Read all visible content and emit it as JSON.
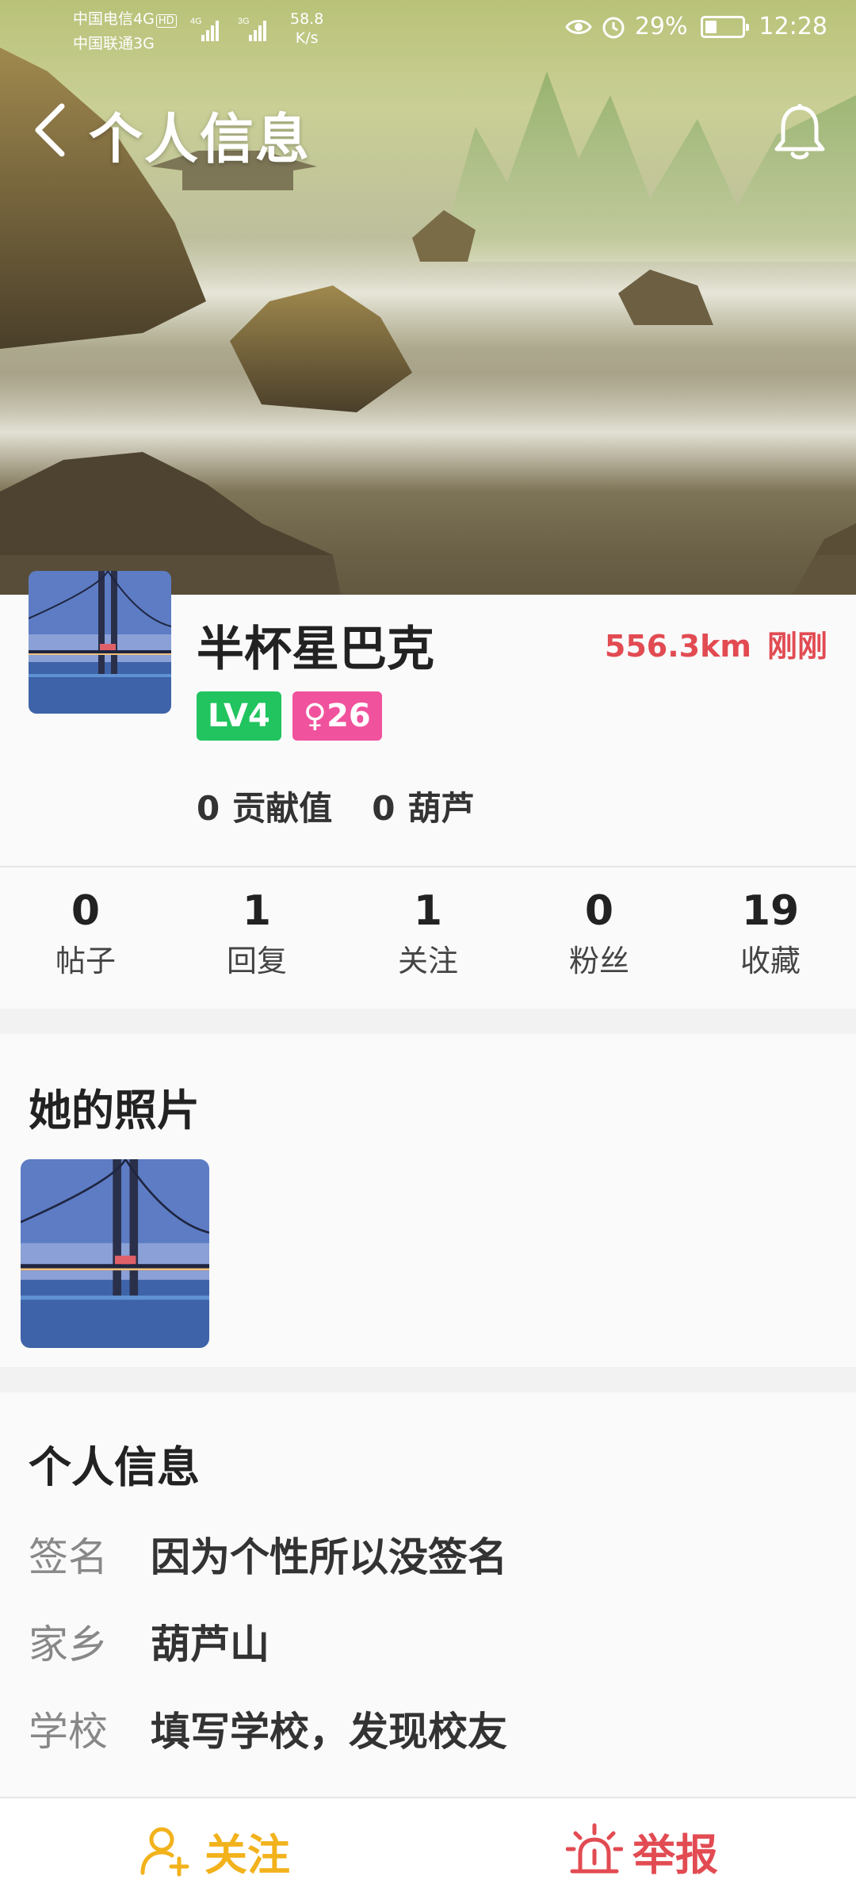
{
  "status_bar": {
    "carrier_1": "中国电信4G",
    "carrier_1_badge": "HD",
    "carrier_2": "中国联通3G",
    "net_1": "4G",
    "net_2": "3G",
    "speed_value": "58.8",
    "speed_unit": "K/s",
    "battery": "29%",
    "time": "12:28"
  },
  "header": {
    "title": "个人信息",
    "back_icon": "chevron-left-icon",
    "notify_icon": "bell-icon"
  },
  "profile": {
    "nickname": "半杯星巴克",
    "distance": "556.3km",
    "last_active": "刚刚",
    "level_badge": "LV4",
    "gender_age_badge": "♀26",
    "contribution_count": "0",
    "contribution_label": "贡献值",
    "gourd_count": "0",
    "gourd_label": "葫芦",
    "colors": {
      "level": "#21c45e",
      "gender": "#f0529d",
      "distance": "#e24b52"
    }
  },
  "counts": [
    {
      "value": "0",
      "label": "帖子"
    },
    {
      "value": "1",
      "label": "回复"
    },
    {
      "value": "1",
      "label": "关注"
    },
    {
      "value": "0",
      "label": "粉丝"
    },
    {
      "value": "19",
      "label": "收藏"
    }
  ],
  "photos": {
    "title": "她的照片"
  },
  "info": {
    "title": "个人信息",
    "rows": [
      {
        "key": "签名",
        "value": "因为个性所以没签名"
      },
      {
        "key": "家乡",
        "value": "葫芦山"
      },
      {
        "key": "学校",
        "value": "填写学校，发现校友"
      }
    ]
  },
  "bottom_bar": {
    "follow_label": "关注",
    "follow_icon": "user-add-icon",
    "report_label": "举报",
    "report_icon": "alarm-siren-icon",
    "colors": {
      "follow": "#f2b21b",
      "report": "#e24b52"
    }
  }
}
